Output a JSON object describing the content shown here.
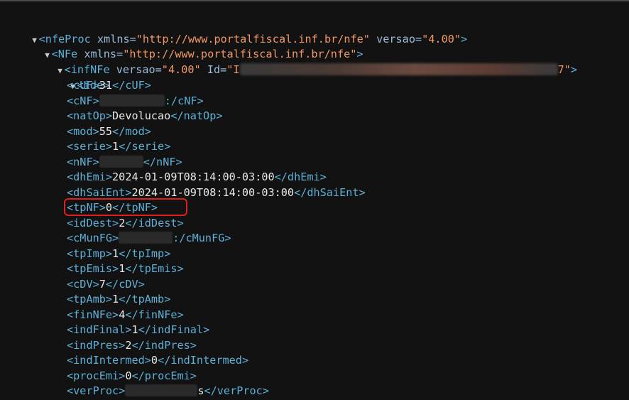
{
  "xml": {
    "nfeProc": {
      "tag": "nfeProc",
      "attr1_name": "xmlns",
      "attr1_value": "\"http://www.portalfiscal.inf.br/nfe\"",
      "attr2_name": "versao",
      "attr2_value": "\"4.00\""
    },
    "nfe": {
      "tag": "NFe",
      "attr1_name": "xmlns",
      "attr1_value": "\"http://www.portalfiscal.inf.br/nfe\""
    },
    "infNFe": {
      "tag": "infNFe",
      "attr1_name": "versao",
      "attr1_value": "\"4.00\"",
      "attr2_name": "Id",
      "attr2_value_start": "\"I",
      "attr2_value_end": "7\""
    },
    "ide": {
      "tag": "ide"
    },
    "fields": [
      {
        "tag": "cUF",
        "value": "31"
      },
      {
        "tag": "cNF",
        "value": ""
      },
      {
        "tag": "natOp",
        "value": "Devolucao"
      },
      {
        "tag": "mod",
        "value": "55"
      },
      {
        "tag": "serie",
        "value": "1"
      },
      {
        "tag": "nNF",
        "value": ""
      },
      {
        "tag": "dhEmi",
        "value": "2024-01-09T08:14:00-03:00"
      },
      {
        "tag": "dhSaiEnt",
        "value": "2024-01-09T08:14:00-03:00"
      },
      {
        "tag": "tpNF",
        "value": "0"
      },
      {
        "tag": "idDest",
        "value": "2"
      },
      {
        "tag": "cMunFG",
        "value": ""
      },
      {
        "tag": "tpImp",
        "value": "1"
      },
      {
        "tag": "tpEmis",
        "value": "1"
      },
      {
        "tag": "cDV",
        "value": "7"
      },
      {
        "tag": "tpAmb",
        "value": "1"
      },
      {
        "tag": "finNFe",
        "value": "4"
      },
      {
        "tag": "indFinal",
        "value": "1"
      },
      {
        "tag": "indPres",
        "value": "2"
      },
      {
        "tag": "indIntermed",
        "value": "0"
      },
      {
        "tag": "procEmi",
        "value": "0"
      },
      {
        "tag": "verProc",
        "value": ""
      }
    ],
    "cNF_trail": ":",
    "cMunFG_trail": ":",
    "verProc_trail": "s"
  },
  "colors": {
    "background": "#121212",
    "tag": "#5db0d7",
    "attribute": "#9bbbdc",
    "attribute_value": "#f29766",
    "text": "#e8e8e8",
    "highlight_border": "#e0201c"
  },
  "icons": {
    "expand_toggle": "triangle-down-icon"
  }
}
